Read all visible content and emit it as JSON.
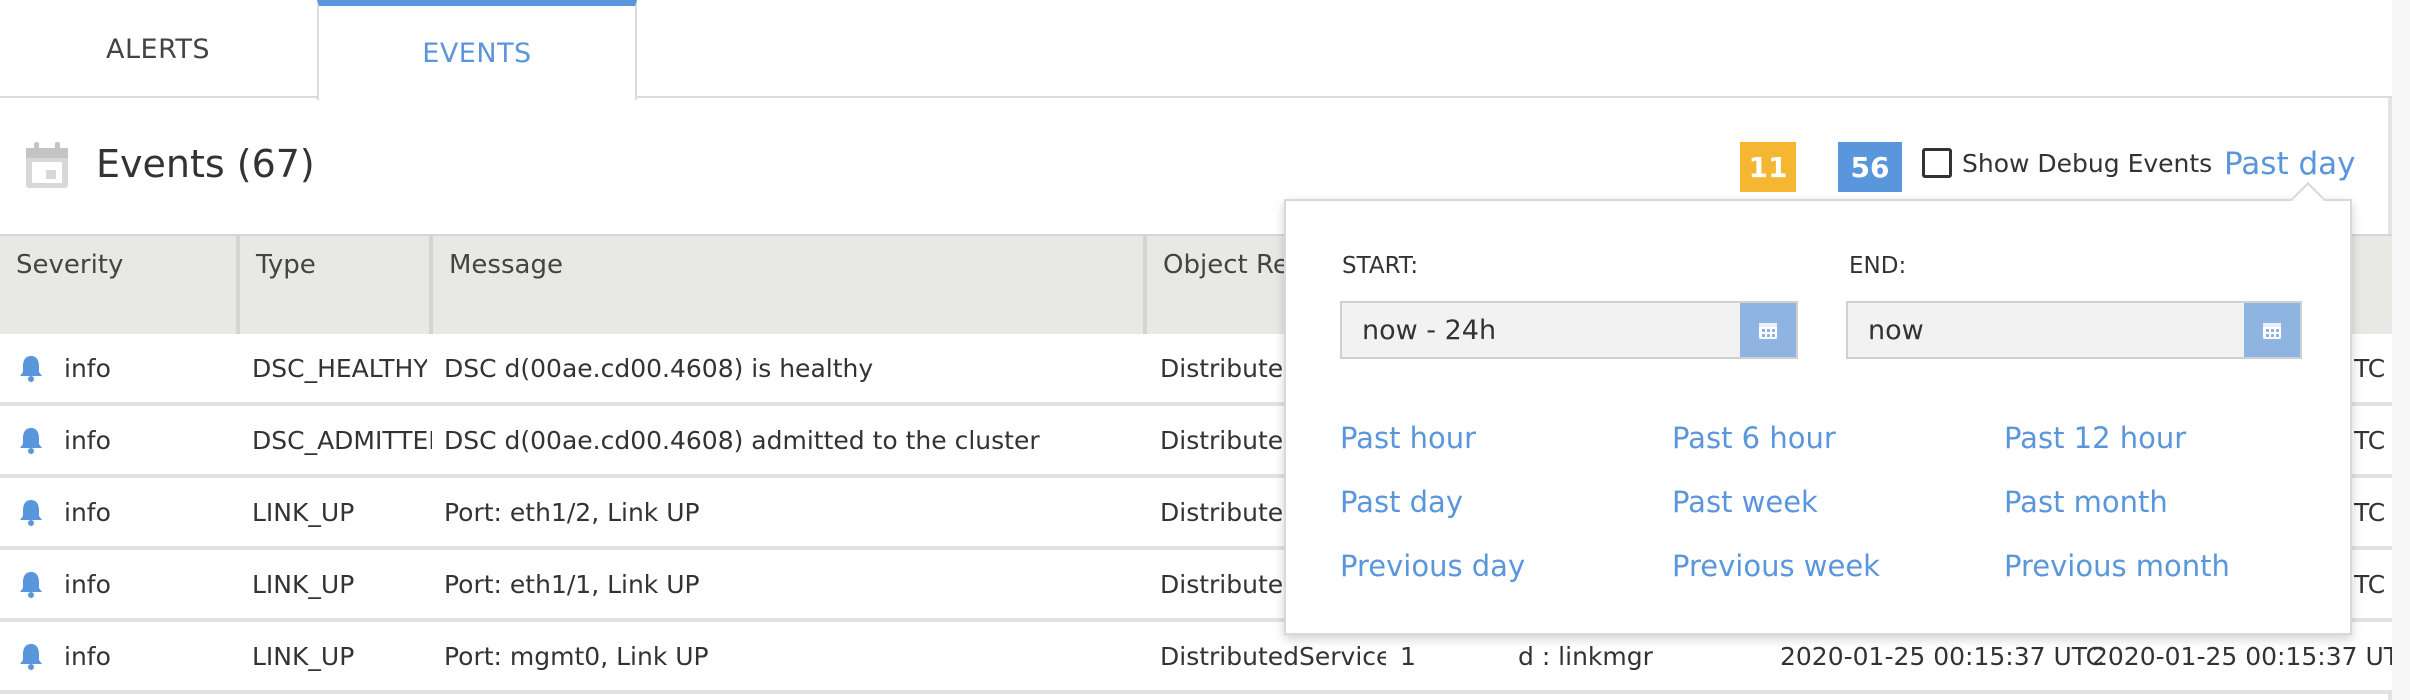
{
  "tabs": [
    {
      "label": "ALERTS"
    },
    {
      "label": "EVENTS"
    }
  ],
  "header": {
    "title": "Events (67)",
    "badge_warning": "11",
    "badge_info": "56",
    "debug_label": "Show Debug Events",
    "range_label": "Past day"
  },
  "table": {
    "columns": [
      "Severity",
      "Type",
      "Message",
      "Object Ref"
    ],
    "rows": [
      {
        "severity": "info",
        "type": "DSC_HEALTHY",
        "message": "DSC d(00ae.cd00.4608) is healthy",
        "object_ref": "DistributedS",
        "tail": "TC"
      },
      {
        "severity": "info",
        "type": "DSC_ADMITTED",
        "message": "DSC d(00ae.cd00.4608) admitted to the cluster",
        "object_ref": "DistributedS",
        "tail": "TC"
      },
      {
        "severity": "info",
        "type": "LINK_UP",
        "message": "Port: eth1/2, Link UP",
        "object_ref": "DistributedS",
        "tail": "TC"
      },
      {
        "severity": "info",
        "type": "LINK_UP",
        "message": "Port: eth1/1, Link UP",
        "object_ref": "DistributedS",
        "tail": "TC"
      },
      {
        "severity": "info",
        "type": "LINK_UP",
        "message": "Port: mgmt0, Link UP",
        "object_ref": "DistributedServiceCa",
        "count": "1",
        "source": "d : linkmgr",
        "created": "2020-01-25 00:15:37 UTC",
        "modified": "2020-01-25 00:15:37 UTC"
      }
    ]
  },
  "date_picker": {
    "start_label": "START:",
    "start_value": "now - 24h",
    "end_label": "END:",
    "end_value": "now",
    "presets": [
      "Past hour",
      "Past 6 hour",
      "Past 12 hour",
      "Past day",
      "Past week",
      "Past month",
      "Previous day",
      "Previous week",
      "Previous month"
    ]
  },
  "colors": {
    "accent": "#5a96db",
    "warning": "#f5b731",
    "header_bg": "#e8e8e5"
  }
}
